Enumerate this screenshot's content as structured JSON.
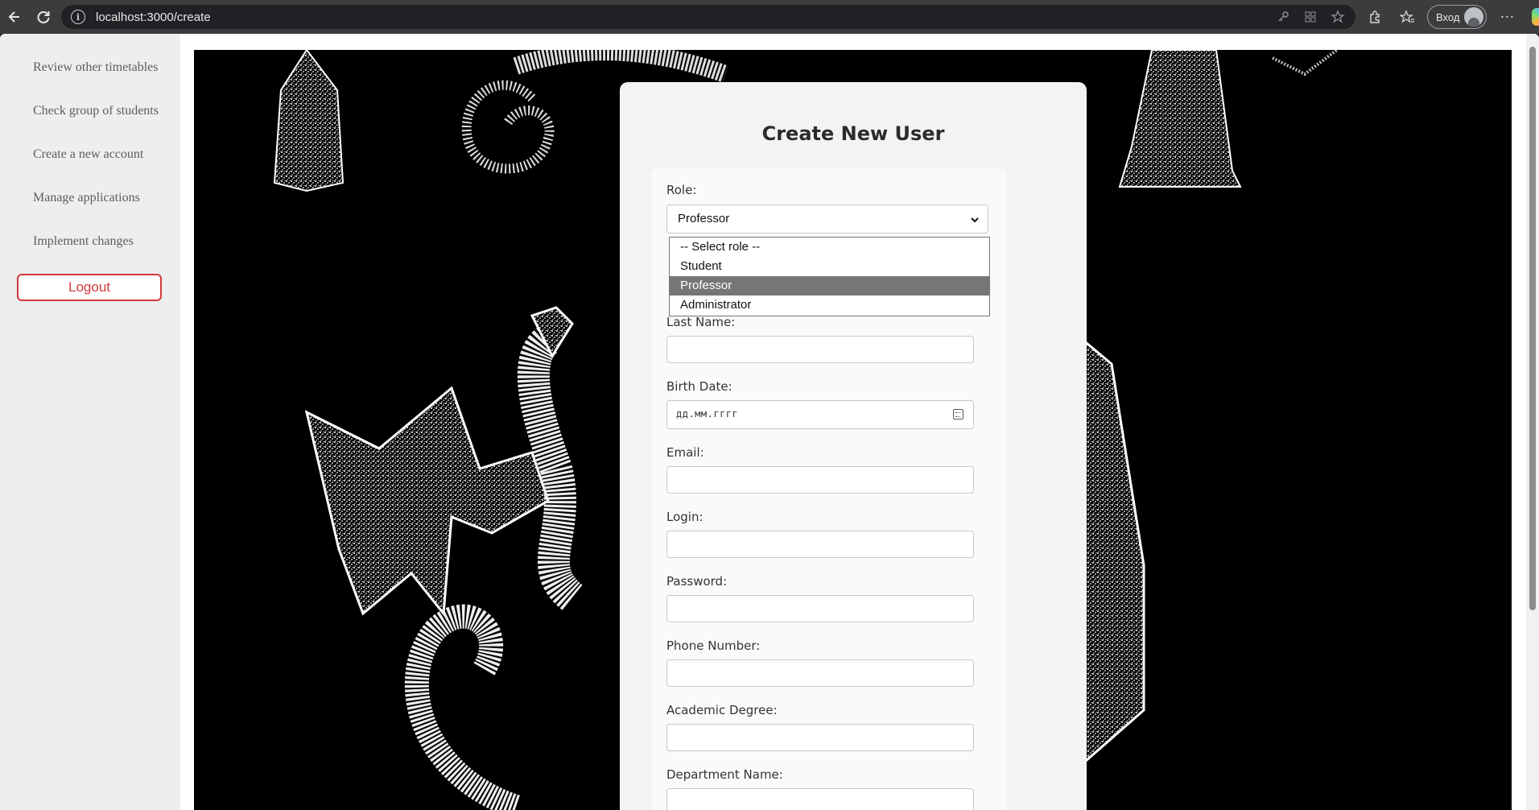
{
  "browser": {
    "url": "localhost:3000/create",
    "login_label": "Вход"
  },
  "sidebar": {
    "items": [
      {
        "label": "Review other timetables"
      },
      {
        "label": "Check group of students"
      },
      {
        "label": "Create a new account"
      },
      {
        "label": "Manage applications"
      },
      {
        "label": "Implement changes"
      }
    ],
    "logout_label": "Logout"
  },
  "form": {
    "title": "Create New User",
    "role": {
      "label": "Role:",
      "value": "Professor",
      "options": [
        "-- Select role --",
        "Student",
        "Professor",
        "Administrator"
      ],
      "highlighted": "Professor"
    },
    "fields": {
      "last_name": {
        "label": "Last Name:",
        "value": ""
      },
      "birth_date": {
        "label": "Birth Date:",
        "placeholder": "дд.мм.гггг"
      },
      "email": {
        "label": "Email:",
        "value": ""
      },
      "login": {
        "label": "Login:",
        "value": ""
      },
      "password": {
        "label": "Password:",
        "value": ""
      },
      "phone": {
        "label": "Phone Number:",
        "value": ""
      },
      "degree": {
        "label": "Academic Degree:",
        "value": ""
      },
      "department": {
        "label": "Department Name:",
        "value": ""
      }
    }
  },
  "colors": {
    "accent_logout": "#d23a3a",
    "sidebar_bg": "#eeeeee",
    "scene_bg": "#000000",
    "option_highlight": "#767676"
  }
}
